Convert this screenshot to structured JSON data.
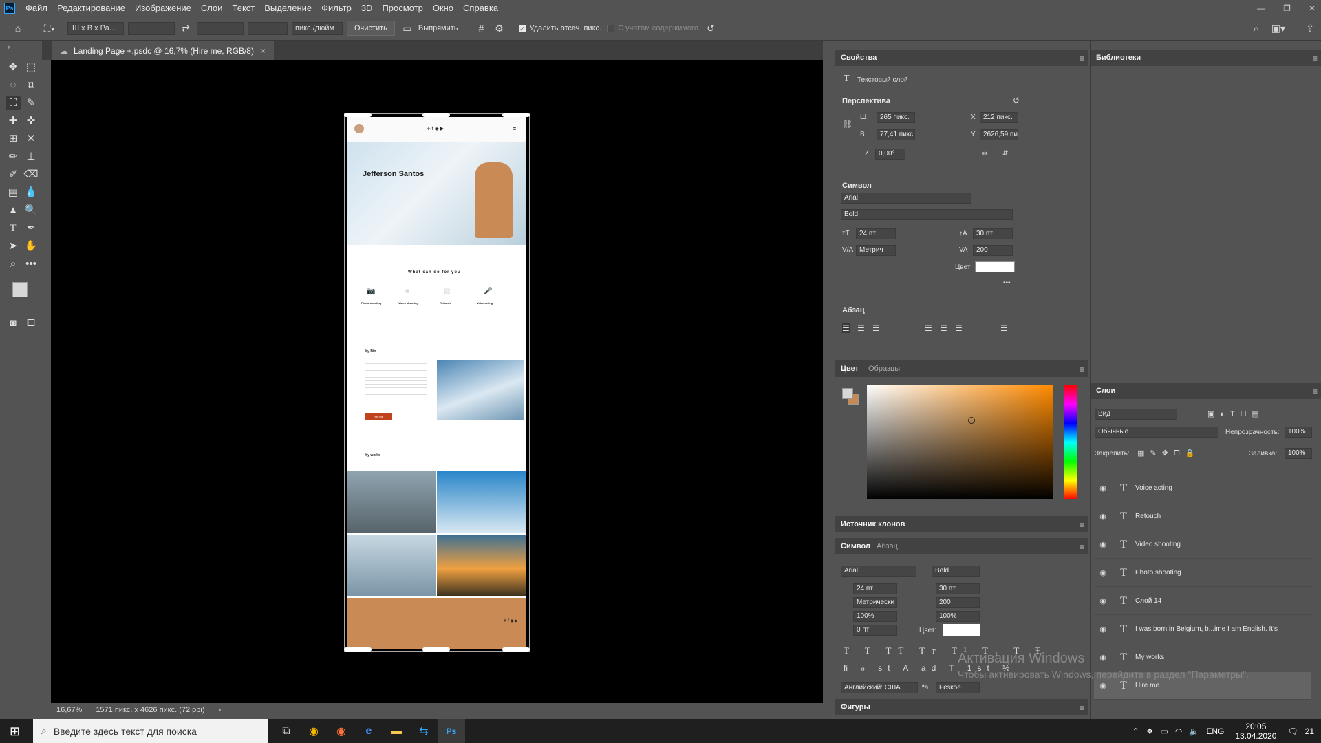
{
  "app": {
    "logo": "Ps"
  },
  "menu": [
    "Файл",
    "Редактирование",
    "Изображение",
    "Слои",
    "Текст",
    "Выделение",
    "Фильтр",
    "3D",
    "Просмотр",
    "Окно",
    "Справка"
  ],
  "options": {
    "ratio": "Ш x В x Ра...",
    "units": "пикс./дюйм",
    "clear": "Очистить",
    "straighten": "Выпрямить",
    "delete_pixels": "Удалить отсеч. пикс.",
    "content_aware": "С учетом содержимого"
  },
  "doc_tab": "Landing Page +.psdc @ 16,7% (Hire me, RGB/8)",
  "status": {
    "zoom": "16,67%",
    "size": "1571 пикс. x 4626 пикс. (72 ppi)"
  },
  "properties": {
    "tab": "Свойства",
    "layer_type": "Текстовый слой",
    "perspective": "Перспектива",
    "w_label": "Ш",
    "w": "265 пикс.",
    "h_label": "В",
    "h": "77,41 пикс.",
    "x_label": "X",
    "x": "212 пикс.",
    "y_label": "Y",
    "y": "2626,59 пи",
    "angle": "0,00°",
    "symbol": "Символ",
    "font": "Arial",
    "style": "Bold",
    "size": "24 пт",
    "leading": "30 пт",
    "kerning": "Метрич",
    "tracking": "200",
    "color_label": "Цвет",
    "paragraph": "Абзац"
  },
  "libraries": {
    "tab": "Библиотеки"
  },
  "color_panel": {
    "tab": "Цвет",
    "tab2": "Образцы"
  },
  "clone_source": "Источник клонов",
  "symbol2": {
    "tab": "Символ",
    "tab2": "Абзац",
    "font": "Arial",
    "style": "Bold",
    "size": "24 пт",
    "leading": "30 пт",
    "kerning": "Метрически",
    "tracking": "200",
    "vscale": "100%",
    "hscale": "100%",
    "baseline": "0 пт",
    "color_label": "Цвет:",
    "lang": "Английский: США",
    "aa": "Резкое"
  },
  "shapes": "Фигуры",
  "layers": {
    "tab": "Слои",
    "filter": "Вид",
    "blend": "Обычные",
    "opacity_label": "Непрозрачность:",
    "opacity": "100%",
    "lock_label": "Закрепить:",
    "fill_label": "Заливка:",
    "fill": "100%",
    "items": [
      "Voice acting",
      "Retouch",
      "Video shooting",
      "Photo shooting",
      "Слой 14",
      "I was born in Belgium, b...ime I am English.  It's",
      "My works",
      "Hire me"
    ]
  },
  "watermark": {
    "line1": "Активация Windows",
    "line2": "Чтобы активировать Windows, перейдите в раздел \"Параметры\"."
  },
  "taskbar": {
    "search": "Введите здесь текст для поиска",
    "lang": "ENG",
    "time": "20:05",
    "date": "13.04.2020",
    "notif": "21"
  },
  "site": {
    "name": "Jefferson Santos",
    "services_title": "What can do for you",
    "services": [
      "Photo shooting",
      "Video shooting",
      "Retouch",
      "Voice acting"
    ],
    "bio_title": "My Bio",
    "hire": "Hire me",
    "works_title": "My works"
  }
}
